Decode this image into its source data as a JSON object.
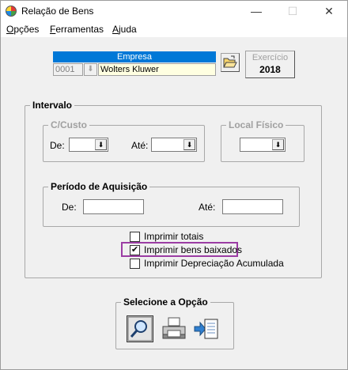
{
  "window": {
    "title": "Relação de Bens",
    "minimize_glyph": "—",
    "maximize_glyph": "☐",
    "close_glyph": "✕"
  },
  "menu": {
    "items": [
      {
        "accel": "O",
        "rest": "pções"
      },
      {
        "accel": "F",
        "rest": "erramentas"
      },
      {
        "accel": "A",
        "rest": "juda"
      }
    ]
  },
  "empresa": {
    "header": "Empresa",
    "code": "0001",
    "name": "Wolters Kluwer",
    "dropdown_glyph": "⬇",
    "folder_icon": "folder-open-icon"
  },
  "exercicio": {
    "label": "Exercício",
    "year": "2018"
  },
  "intervalo": {
    "title": "Intervalo",
    "ccusto": {
      "title": "C/Custo",
      "de_label": "De:",
      "ate_label": "Até:"
    },
    "local_fisico": {
      "title": "Local Físico"
    },
    "periodo": {
      "title": "Período de Aquisição",
      "de_label": "De:",
      "ate_label": "Até:"
    },
    "combo_glyph": "⬇"
  },
  "options": {
    "imprimir_totais": {
      "label": "Imprimir totais",
      "checked": false
    },
    "imprimir_baixados": {
      "label": "Imprimir bens baixados",
      "checked": true
    },
    "imprimir_depreciacao": {
      "label": "Imprimir Depreciação Acumulada",
      "checked": false
    },
    "check_glyph": "✔"
  },
  "selecione": {
    "title": "Selecione a Opção",
    "buttons": [
      {
        "icon": "magnifier-preview-icon"
      },
      {
        "icon": "printer-icon"
      },
      {
        "icon": "export-document-icon"
      }
    ]
  },
  "colors": {
    "accent": "#0078d7",
    "highlight": "#9b3da4",
    "window_bg": "#f0f0f0",
    "empresa_field_bg": "#ffffe1"
  }
}
